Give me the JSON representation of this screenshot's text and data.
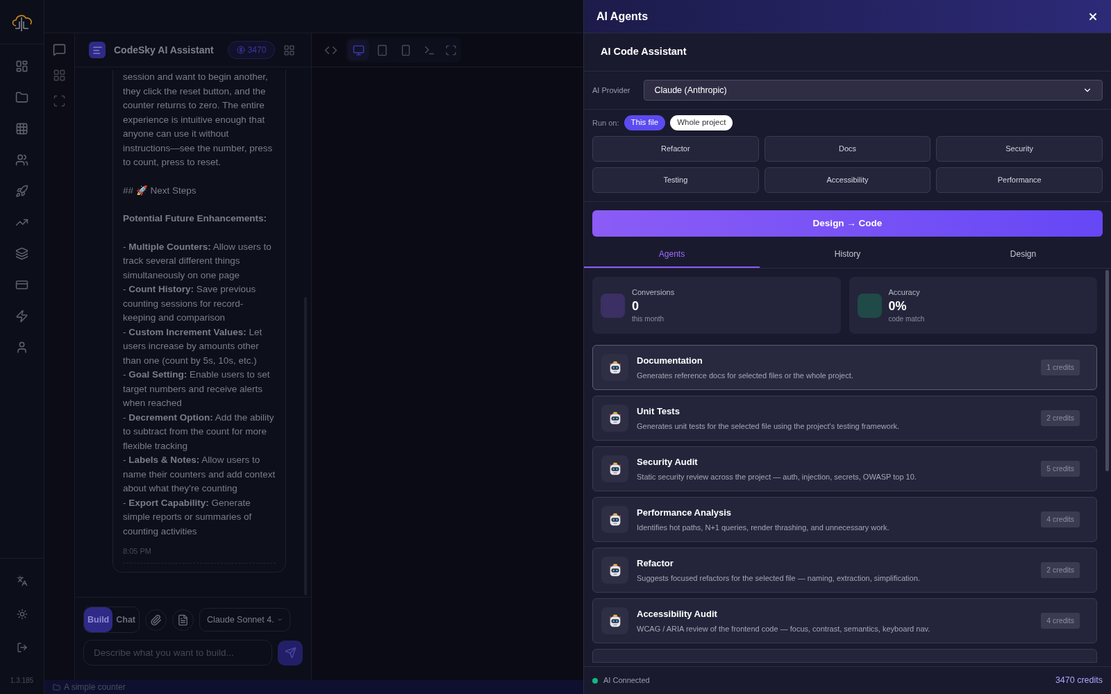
{
  "sidebar": {
    "version": "1.3.185"
  },
  "chat": {
    "title": "CodeSky AI Assistant",
    "credits": "3470",
    "message": {
      "blocks": [
        {
          "kind": "text",
          "text": "session and want to begin another, they click the reset button, and the counter returns to zero. The entire experience is intuitive enough that anyone can use it without instructions—see the number, press to count, press to reset."
        },
        {
          "kind": "heading",
          "text": "## 🚀 Next Steps"
        },
        {
          "kind": "bold",
          "text": "Potential Future Enhancements:"
        },
        {
          "kind": "bullet",
          "text": "- **Multiple Counters:** Allow users to track several different things simultaneously on one page"
        },
        {
          "kind": "bullet",
          "text": "- **Count History:** Save previous counting sessions for record-keeping and comparison"
        },
        {
          "kind": "bullet",
          "text": "- **Custom Increment Values:** Let users increase by amounts other than one (count by 5s, 10s, etc.)"
        },
        {
          "kind": "bullet",
          "text": "- **Goal Setting:** Enable users to set target numbers and receive alerts when reached"
        },
        {
          "kind": "bullet",
          "text": "- **Decrement Option:** Add the ability to subtract from the count for more flexible tracking"
        },
        {
          "kind": "bullet",
          "text": "- **Labels & Notes:** Allow users to name their counters and add context about what they're counting"
        },
        {
          "kind": "bullet",
          "text": "- **Export Capability:** Generate simple reports or summaries of counting activities"
        }
      ],
      "time": "8:05 PM"
    },
    "modes": [
      {
        "label": "Build",
        "selected": true
      },
      {
        "label": "Chat",
        "selected": false
      }
    ],
    "model": "Claude Sonnet 4.",
    "input": {
      "placeholder": "Describe what you want to build..."
    }
  },
  "preview_toolbar": {
    "views": [
      {
        "kind": "desktop",
        "selected": true
      },
      {
        "kind": "tablet",
        "selected": false
      },
      {
        "kind": "mobile",
        "selected": false
      }
    ]
  },
  "status_bar": {
    "project": "A simple counter"
  },
  "drawer": {
    "title": "AI Agents",
    "section_title": "AI Code Assistant",
    "provider": {
      "label": "AI Provider",
      "value": "Claude (Anthropic)"
    },
    "run_on": {
      "label": "Run on:",
      "options": [
        {
          "label": "This file",
          "selected": true
        },
        {
          "label": "Whole project",
          "selected": false
        }
      ]
    },
    "quick_actions": [
      "Refactor",
      "Docs",
      "Security",
      "Testing",
      "Accessibility",
      "Performance"
    ],
    "primary_button": "Design → Code",
    "tabs": [
      {
        "label": "Agents",
        "selected": true
      },
      {
        "label": "History",
        "selected": false
      },
      {
        "label": "Design",
        "selected": false
      }
    ],
    "stats": [
      {
        "label": "Conversions",
        "value": "0",
        "caption": "this month",
        "color": "#3b2f63"
      },
      {
        "label": "Accuracy",
        "value": "0%",
        "caption": "code match",
        "color": "#1f4a47"
      }
    ],
    "agents": [
      {
        "name": "Documentation",
        "description": "Generates reference docs for selected files or the whole project.",
        "cost": "1 credits",
        "selected": true
      },
      {
        "name": "Unit Tests",
        "description": "Generates unit tests for the selected file using the project's testing framework.",
        "cost": "2 credits",
        "selected": false
      },
      {
        "name": "Security Audit",
        "description": "Static security review across the project — auth, injection, secrets, OWASP top 10.",
        "cost": "5 credits",
        "selected": false
      },
      {
        "name": "Performance Analysis",
        "description": "Identifies hot paths, N+1 queries, render thrashing, and unnecessary work.",
        "cost": "4 credits",
        "selected": false
      },
      {
        "name": "Refactor",
        "description": "Suggests focused refactors for the selected file — naming, extraction, simplification.",
        "cost": "2 credits",
        "selected": false
      },
      {
        "name": "Accessibility Audit",
        "description": "WCAG / ARIA review of the frontend code — focus, contrast, semantics, keyboard nav.",
        "cost": "4 credits",
        "selected": false
      }
    ],
    "footer": {
      "connected": true,
      "status": "AI Connected",
      "credits": "3470 credits"
    }
  }
}
